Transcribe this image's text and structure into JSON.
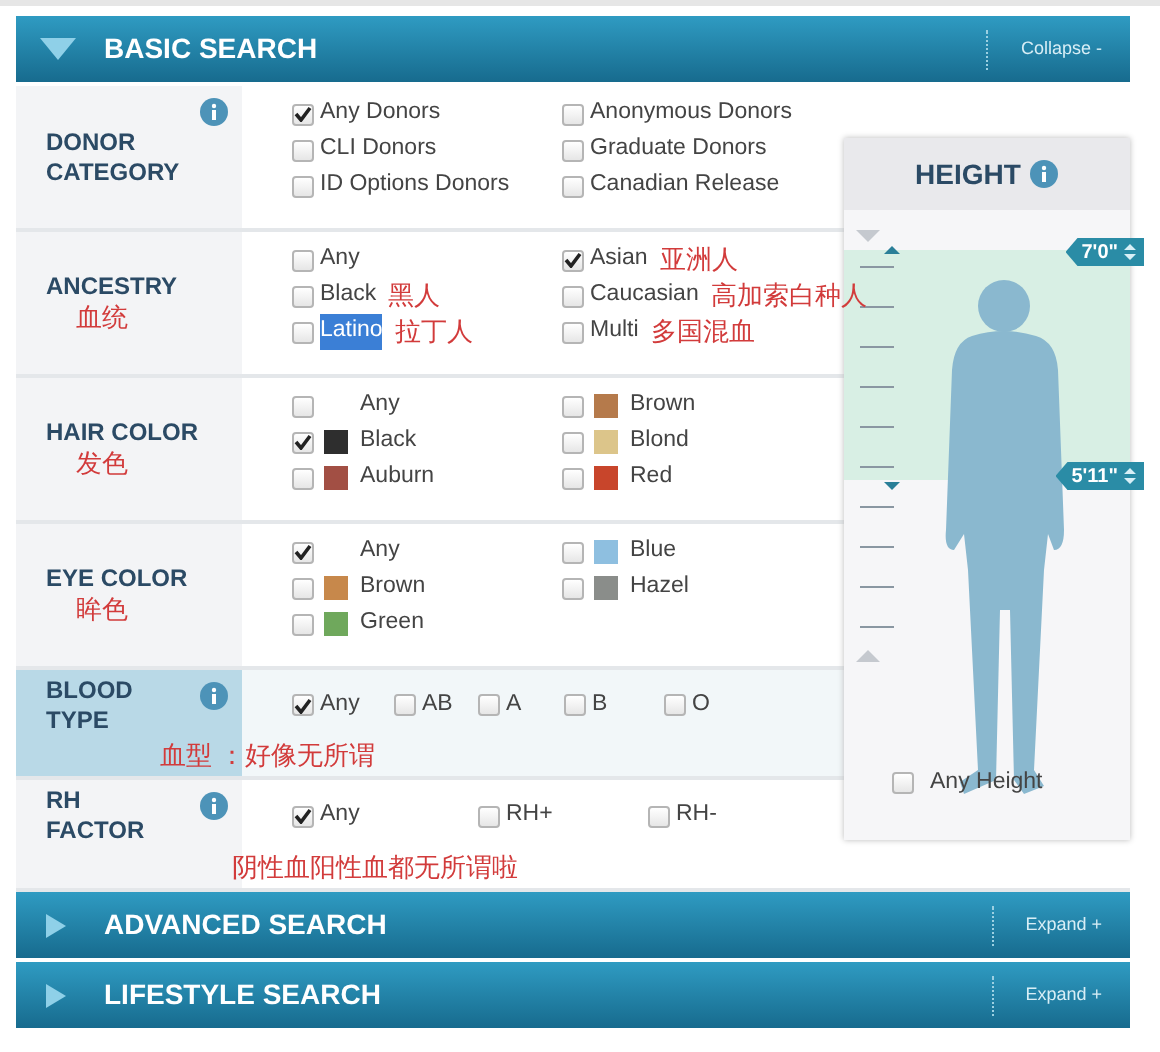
{
  "header": {
    "title": "BASIC SEARCH",
    "expanded": true,
    "action": "Collapse -"
  },
  "sections": [
    {
      "label": [
        "DONOR",
        "CATEGORY"
      ],
      "info": true,
      "kind": "grid",
      "selected": false,
      "options": [
        {
          "label": "Any Donors",
          "checked": true
        },
        {
          "label": "Anonymous Donors",
          "checked": false
        },
        {
          "label": "CLI Donors",
          "checked": false
        },
        {
          "label": "Graduate Donors",
          "checked": false
        },
        {
          "label": "ID Options Donors",
          "checked": false
        },
        {
          "label": "Canadian Release",
          "checked": false
        }
      ]
    },
    {
      "label": [
        "ANCESTRY"
      ],
      "note": "血统",
      "info": false,
      "kind": "grid",
      "selected": false,
      "options": [
        {
          "label": "Any",
          "checked": false
        },
        {
          "label": "Asian",
          "checked": true,
          "note": "亚洲人"
        },
        {
          "label": "Black",
          "checked": false,
          "note": "黑人"
        },
        {
          "label": "Caucasian",
          "checked": false,
          "note": "高加索白种人"
        },
        {
          "label": "Latino",
          "checked": false,
          "highlighted": true,
          "note": "拉丁人"
        },
        {
          "label": "Multi",
          "checked": false,
          "note": "多国混血"
        }
      ]
    },
    {
      "label": [
        "HAIR COLOR"
      ],
      "note": "发色",
      "info": false,
      "kind": "swatch",
      "selected": false,
      "options": [
        {
          "label": "Any",
          "checked": false
        },
        {
          "label": "Brown",
          "checked": false,
          "color": "#b57a4b"
        },
        {
          "label": "Black",
          "checked": true,
          "color": "#2e2e2e"
        },
        {
          "label": "Blond",
          "checked": false,
          "color": "#dcc58a"
        },
        {
          "label": "Auburn",
          "checked": false,
          "color": "#a24f44"
        },
        {
          "label": "Red",
          "checked": false,
          "color": "#c8452b"
        }
      ]
    },
    {
      "label": [
        "EYE COLOR"
      ],
      "note": "眸色",
      "info": false,
      "kind": "swatch",
      "selected": false,
      "options": [
        {
          "label": "Any",
          "checked": true
        },
        {
          "label": "Blue",
          "checked": false,
          "color": "#8ebfe0"
        },
        {
          "label": "Brown",
          "checked": false,
          "color": "#c7884b"
        },
        {
          "label": "Hazel",
          "checked": false,
          "color": "#8a8d8a"
        },
        {
          "label": "Green",
          "checked": false,
          "color": "#6fa85c"
        }
      ]
    },
    {
      "label": [
        "BLOOD",
        "TYPE"
      ],
      "footnote": "血型 ：好像无所谓",
      "info": true,
      "kind": "blood",
      "selected": true,
      "options": [
        {
          "label": "Any",
          "checked": true
        },
        {
          "label": "AB",
          "checked": false
        },
        {
          "label": "A",
          "checked": false
        },
        {
          "label": "B",
          "checked": false
        },
        {
          "label": "O",
          "checked": false
        }
      ]
    },
    {
      "label": [
        "RH",
        "FACTOR"
      ],
      "footnote": "阴性血阳性血都无所谓啦",
      "info": true,
      "kind": "rh",
      "selected": false,
      "options": [
        {
          "label": "Any",
          "checked": true
        },
        {
          "label": "RH+",
          "checked": false
        },
        {
          "label": "RH-",
          "checked": false
        }
      ]
    }
  ],
  "height": {
    "title": "HEIGHT",
    "info": true,
    "upper": "7'0\"",
    "lower": "5'11\"",
    "any_label": "Any Height",
    "any_checked": false
  },
  "collapsed_panels": [
    {
      "title": "ADVANCED SEARCH",
      "expanded": false,
      "action": "Expand +"
    },
    {
      "title": "LIFESTYLE SEARCH",
      "expanded": false,
      "action": "Expand +"
    }
  ]
}
